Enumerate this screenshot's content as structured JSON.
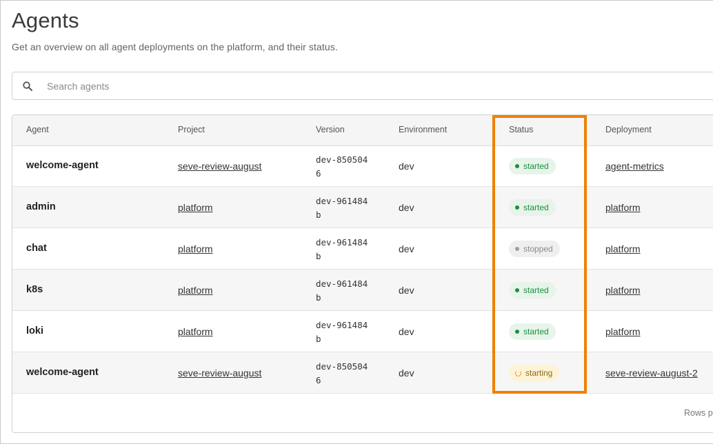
{
  "header": {
    "title": "Agents",
    "subtitle": "Get an overview on all agent deployments on the platform, and their status."
  },
  "search": {
    "placeholder": "Search agents",
    "value": ""
  },
  "table": {
    "columns": {
      "agent": "Agent",
      "project": "Project",
      "version": "Version",
      "environment": "Environment",
      "status": "Status",
      "deployment": "Deployment"
    },
    "rows": [
      {
        "agent": "welcome-agent",
        "project": "seve-review-august",
        "version": "dev-8505046",
        "environment": "dev",
        "status": "started",
        "deployment": "agent-metrics"
      },
      {
        "agent": "admin",
        "project": "platform",
        "version": "dev-961484b",
        "environment": "dev",
        "status": "started",
        "deployment": "platform"
      },
      {
        "agent": "chat",
        "project": "platform",
        "version": "dev-961484b",
        "environment": "dev",
        "status": "stopped",
        "deployment": "platform"
      },
      {
        "agent": "k8s",
        "project": "platform",
        "version": "dev-961484b",
        "environment": "dev",
        "status": "started",
        "deployment": "platform"
      },
      {
        "agent": "loki",
        "project": "platform",
        "version": "dev-961484b",
        "environment": "dev",
        "status": "started",
        "deployment": "platform"
      },
      {
        "agent": "welcome-agent",
        "project": "seve-review-august",
        "version": "dev-8505046",
        "environment": "dev",
        "status": "starting",
        "deployment": "seve-review-august-2"
      }
    ],
    "footer": {
      "rows_per_page_label": "Rows p"
    }
  },
  "colors": {
    "highlight": "#f08000",
    "started": "#1e8e3e",
    "stopped": "#9e9e9e",
    "starting": "#e0a21b"
  }
}
